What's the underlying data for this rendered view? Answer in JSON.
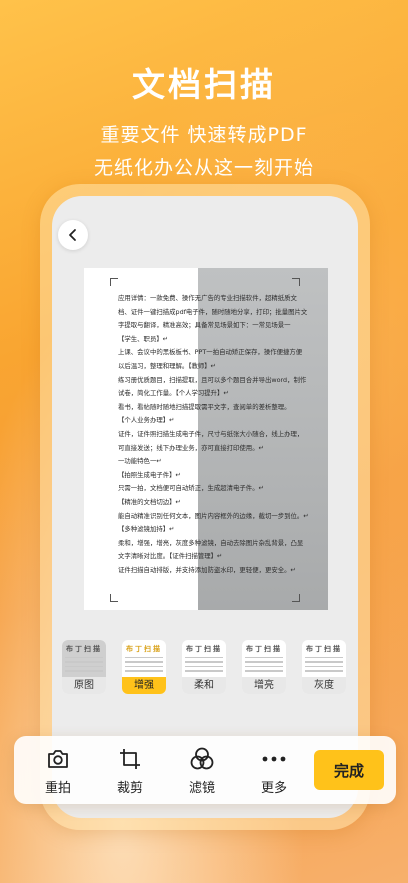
{
  "hero": {
    "title": "文档扫描",
    "subtitle": "重要文件  快速转成PDF",
    "subtitle2": "无纸化办公从这一刻开始"
  },
  "document": {
    "lines": [
      "应用详情：一款免费、操作无广告的专业扫描软件，超精纸质文",
      "档、证件一键扫描成pdf电子件，随时随地分享，打印；批量图片文",
      "字提取与翻译，精准高效；具备常见场景如下：一常见场景一",
      "【学生、职员】↵",
      "上课、会议中的黑板板书、PPT一拍自动矫正保存，操作便捷方便",
      "以后温习，整理和理解。【教师】↵",
      "练习册优质题目，扫描提取，且可以多个题目合并导出word，制作",
      "试卷，简化工作量。【个人学习提升】↵",
      "看书，看帖随时随地扫描提取需平文字，查阅单的差析整理。",
      "【个人业务办理】↵",
      "证件，证件照扫描生成电子件，尺寸与纸张大小随合，线上办理，",
      "可直接发送；线下办理业务，亦可直接打印使用。↵",
      "一功能特色一↵",
      "【拍照生成电子件】↵",
      "只需一拍，文档便可自动矫正，生成超清电子件。↵",
      "【精准的文档切边】↵",
      "能自动精准识别任何文本，图片内容框外的边缘，截切一步到位。↵",
      "【多种滤镜加持】↵",
      "柔和，增强，增亮，灰度多种滤镜，自动去除图片杂乱背景，凸显",
      "文字清晰对比度。【证件扫描管理】↵",
      "证件扫描自动排版，并支持添加防盗水印，更轻便，更安全。↵"
    ]
  },
  "filters": {
    "thumb_title": "布丁扫描",
    "items": [
      {
        "label": "原图"
      },
      {
        "label": "增强"
      },
      {
        "label": "柔和"
      },
      {
        "label": "增亮"
      },
      {
        "label": "灰度"
      }
    ]
  },
  "toolbar": {
    "retake": "重拍",
    "crop": "裁剪",
    "filter": "滤镜",
    "more": "更多",
    "done": "完成"
  },
  "colors": {
    "accent": "#ffc21a",
    "background": "#f9a531"
  }
}
